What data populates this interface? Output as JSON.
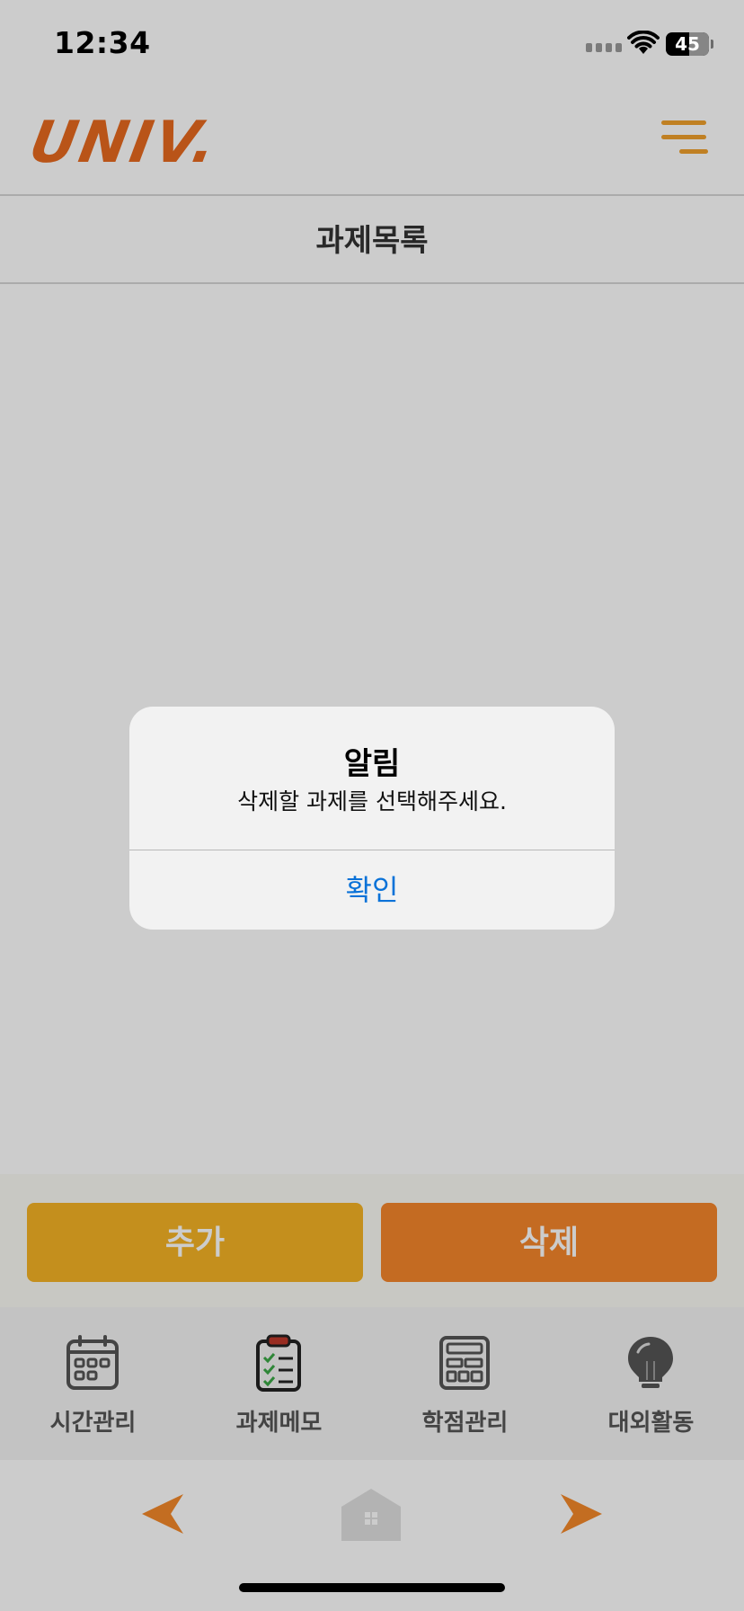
{
  "status_bar": {
    "time": "12:34",
    "battery": "45"
  },
  "header": {
    "logo": "UNIV."
  },
  "page": {
    "title": "과제목록"
  },
  "actions": {
    "add_label": "추가",
    "delete_label": "삭제"
  },
  "tabs": [
    {
      "label": "시간관리",
      "icon": "calendar-icon"
    },
    {
      "label": "과제메모",
      "icon": "clipboard-checklist-icon"
    },
    {
      "label": "학점관리",
      "icon": "calculator-icon"
    },
    {
      "label": "대외활동",
      "icon": "lightbulb-icon"
    }
  ],
  "alert": {
    "title": "알림",
    "message": "삭제할 과제를 선택해주세요.",
    "ok_label": "확인"
  },
  "colors": {
    "brand_orange": "#e86a1f",
    "add_button": "#f5b325",
    "delete_button": "#f6862b",
    "alert_link": "#0a72d8",
    "menu_icon": "#f0a12c"
  }
}
